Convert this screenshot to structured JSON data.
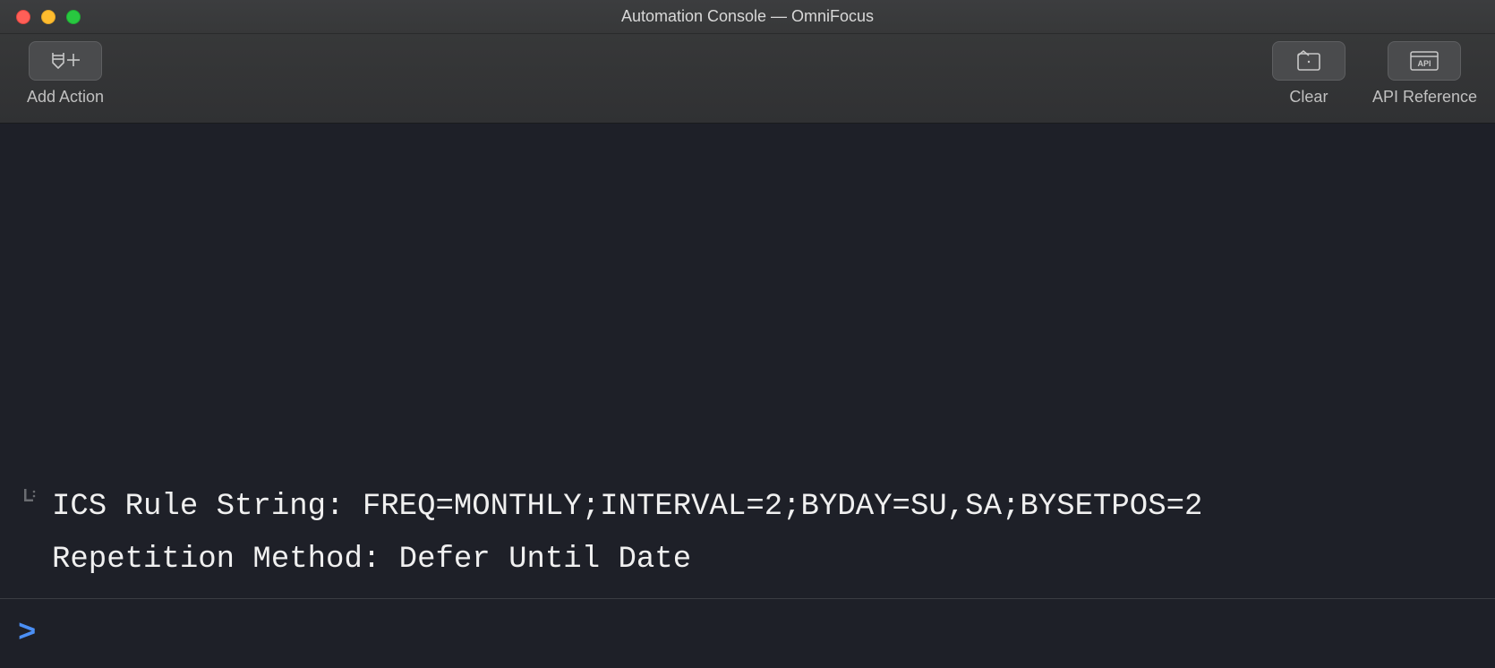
{
  "window": {
    "title": "Automation Console — OmniFocus"
  },
  "toolbar": {
    "add_action_label": "Add Action",
    "clear_label": "Clear",
    "api_reference_label": "API Reference"
  },
  "console": {
    "output_line1": "ICS Rule String: FREQ=MONTHLY;INTERVAL=2;BYDAY=SU,SA;BYSETPOS=2",
    "output_line2": "Repetition Method: Defer Until Date",
    "prompt_symbol": ">",
    "input_value": ""
  }
}
